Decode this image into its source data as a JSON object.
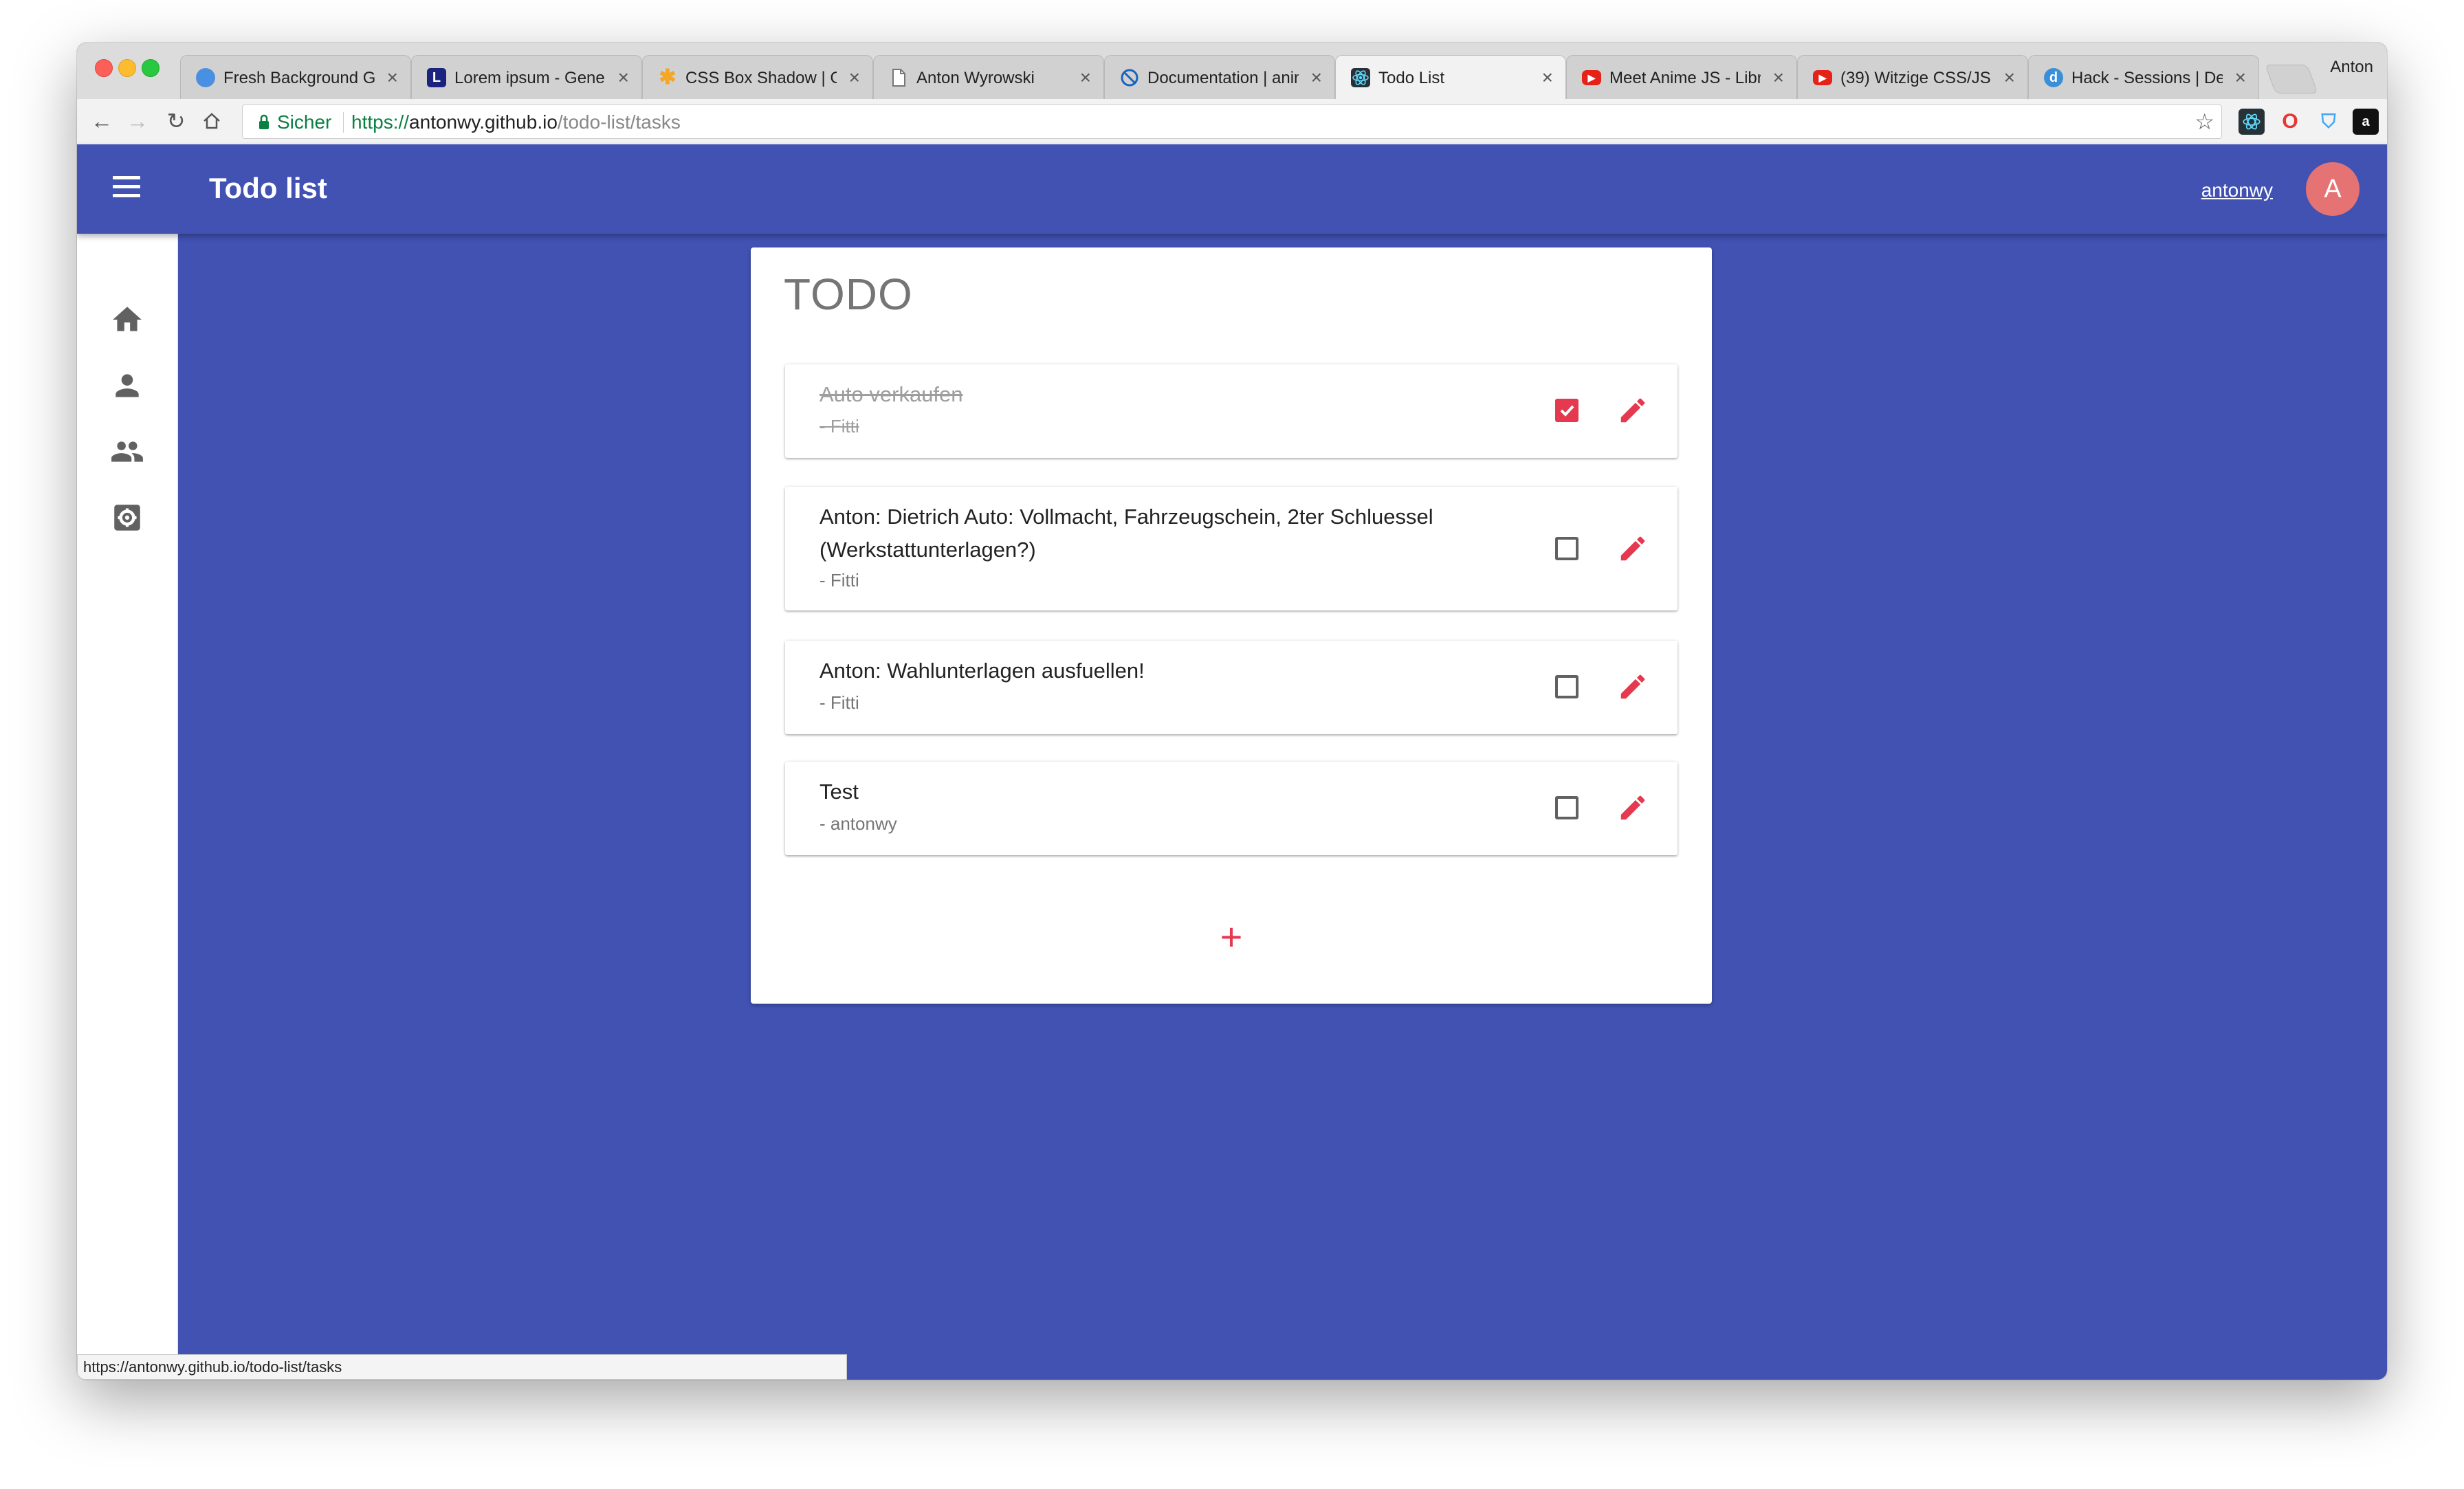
{
  "browser": {
    "tabs": [
      {
        "title": "Fresh Background Gallery",
        "favicon": "blue-sphere-icon",
        "color": "#4a90e2"
      },
      {
        "title": "Lorem ipsum - Generator",
        "favicon": "letter-l-icon",
        "color": "#1a237e"
      },
      {
        "title": "CSS Box Shadow | CSS",
        "favicon": "asterisk-icon",
        "color": "#f5a623"
      },
      {
        "title": "Anton Wyrowski",
        "favicon": "page-icon",
        "color": "#9e9e9e"
      },
      {
        "title": "Documentation | anime",
        "favicon": "anime-icon",
        "color": "#1565c0"
      },
      {
        "title": "Todo List",
        "favicon": "react-icon",
        "color": "#263238"
      },
      {
        "title": "Meet Anime JS - Library",
        "favicon": "youtube-icon",
        "color": "#e62117"
      },
      {
        "title": "(39) Witzige CSS/JS",
        "favicon": "youtube-icon",
        "color": "#e62117"
      },
      {
        "title": "Hack - Sessions | Dev",
        "favicon": "letter-d-icon",
        "color": "#3a8fd9"
      }
    ],
    "active_tab_index": 5,
    "profile_name": "Anton",
    "secure_label": "Sicher",
    "url_scheme": "https://",
    "url_host": "antonwy.github.io",
    "url_path": "/todo-list/tasks",
    "status_url": "https://antonwy.github.io/todo-list/tasks"
  },
  "app": {
    "title": "Todo list",
    "user_name": "antonwy",
    "avatar_letter": "A",
    "primary_color": "#4152b3",
    "accent_color": "#e53950"
  },
  "sidebar": {
    "items": [
      "home-icon",
      "person-icon",
      "group-icon",
      "settings-icon"
    ]
  },
  "todo": {
    "heading": "TODO",
    "items": [
      {
        "text": "Auto verkaufen",
        "author": "- Fitti",
        "done": true
      },
      {
        "text": "Anton: Dietrich Auto: Vollmacht, Fahrzeugschein, 2ter Schluessel (Werkstattunterlagen?)",
        "author": "- Fitti",
        "done": false
      },
      {
        "text": "Anton: Wahlunterlagen ausfuellen!",
        "author": "- Fitti",
        "done": false
      },
      {
        "text": "Test",
        "author": "- antonwy",
        "done": false
      }
    ],
    "add_label": "+"
  }
}
